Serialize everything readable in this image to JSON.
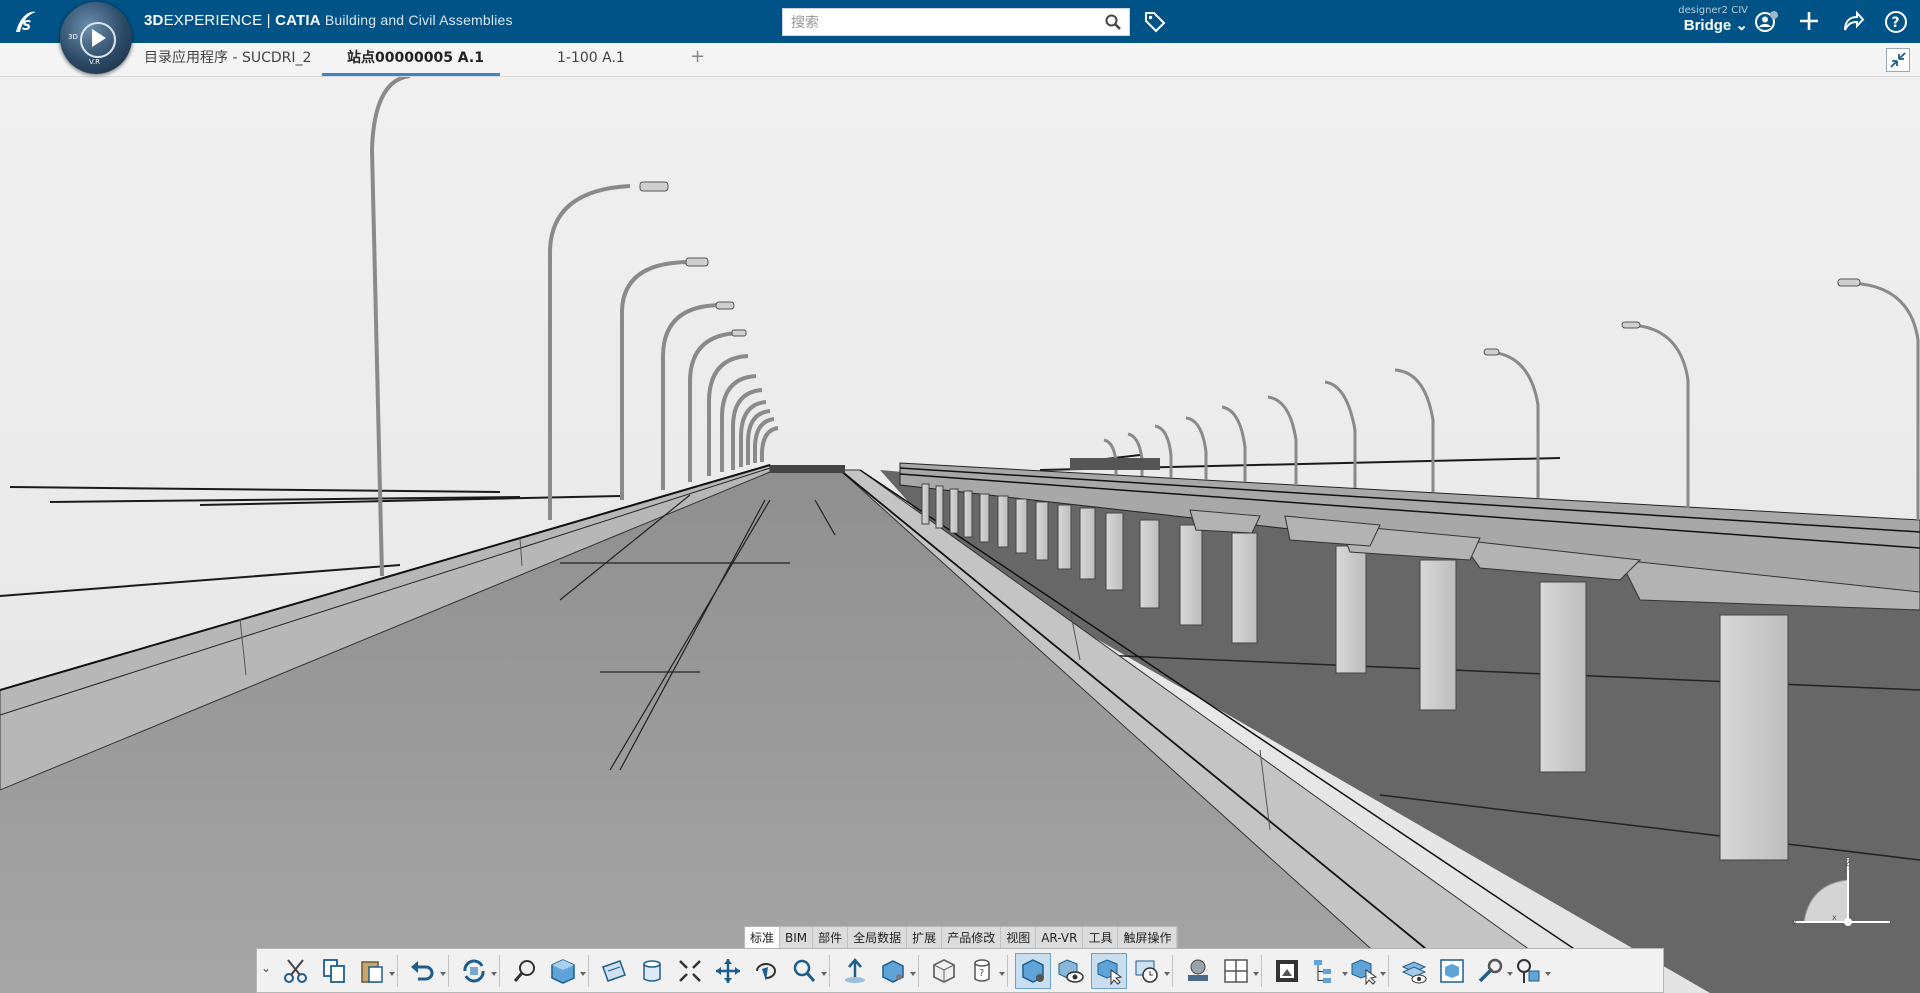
{
  "header": {
    "brand_3d": "3D",
    "brand_experience": "EXPERIENCE | ",
    "brand_catia": "CATIA",
    "app_name": "Building and Civil Assemblies",
    "compass_labels": {
      "left": "3D",
      "bottom": "V.R"
    },
    "search": {
      "placeholder": "搜索",
      "value": ""
    },
    "user": {
      "name": "designer2 CIV",
      "context": "Bridge"
    }
  },
  "tabs": [
    {
      "label": "目录应用程序 - SUCDRI_2",
      "active": false
    },
    {
      "label": "站点00000005 A.1",
      "active": true
    },
    {
      "label": "1-100 A.1",
      "active": false
    }
  ],
  "tab_add_label": "+",
  "category_tabs": [
    {
      "label": "标准",
      "active": true
    },
    {
      "label": "BIM",
      "active": false
    },
    {
      "label": "部件",
      "active": false
    },
    {
      "label": "全局数据",
      "active": false
    },
    {
      "label": "扩展",
      "active": false
    },
    {
      "label": "产品修改",
      "active": false
    },
    {
      "label": "视图",
      "active": false
    },
    {
      "label": "AR-VR",
      "active": false
    },
    {
      "label": "工具",
      "active": false
    },
    {
      "label": "触屏操作",
      "active": false
    }
  ],
  "compass_axes": {
    "z": "Z",
    "y": "y",
    "x": "x"
  },
  "colors": {
    "topbar": "#005386",
    "tab_underline": "#3a86c4",
    "sky": "#ededed",
    "deck": "#9b9b9b",
    "ground": "#666666"
  },
  "toolbar_icons": [
    "cut-icon",
    "copy-icon",
    "paste-icon",
    "undo-icon",
    "update-icon",
    "zoom-search-icon",
    "cube-icon",
    "section-icon",
    "cylinder-icon",
    "fit-all-icon",
    "pan-icon",
    "rotate-icon",
    "zoom-icon",
    "walk-icon",
    "view-mode-icon",
    "wireframe-icon",
    "cylinder-help-icon",
    "render-icon",
    "hide-show-icon",
    "selection-icon",
    "timer-icon",
    "material-icon",
    "layout-icon",
    "capture-icon",
    "tree-icon",
    "select-cube-icon",
    "layers-icon",
    "save-view-icon",
    "tools-icon",
    "properties-icon"
  ]
}
